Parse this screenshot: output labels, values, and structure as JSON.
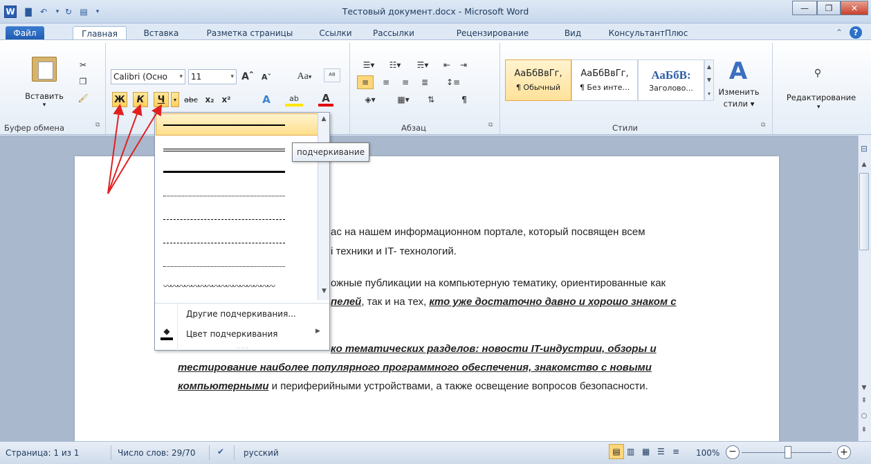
{
  "window": {
    "title": "Тестовый документ.docx - Microsoft Word",
    "app_icon": "W"
  },
  "tabs": [
    "Файл",
    "Главная",
    "Вставка",
    "Разметка страницы",
    "Ссылки",
    "Рассылки",
    "Рецензирование",
    "Вид",
    "КонсультантПлюс"
  ],
  "clipboard": {
    "paste_label": "Вставить",
    "group_label": "Буфер обмена"
  },
  "font": {
    "name": "Calibri (Осно",
    "size": "11",
    "bold": "Ж",
    "italic": "К",
    "underline": "Ч",
    "strike": "abc",
    "sub": "x₂",
    "sup": "x²",
    "aa": "Aa"
  },
  "paragraph": {
    "group_label": "Абзац",
    "pilcrow": "¶"
  },
  "styles": {
    "group_label": "Стили",
    "items": [
      {
        "preview": "АаБбВвГг,",
        "name": "¶ Обычный"
      },
      {
        "preview": "АаБбВвГг,",
        "name": "¶ Без инте..."
      },
      {
        "preview": "АаБбВ:",
        "name": "Заголово..."
      }
    ],
    "change_label": "Изменить стили",
    "change_l1": "Изменить",
    "change_l2": "стили ▾"
  },
  "editing": {
    "label": "Редактирование"
  },
  "dropdown": {
    "tooltip": "подчеркивание",
    "more_underlines": "Другие подчеркивания...",
    "underline_color": "Цвет подчеркивания"
  },
  "document": {
    "lines": [
      {
        "text": "ас на нашем информационном портале, который посвящен всем"
      },
      {
        "text": "і техники и IT- технологий."
      },
      {
        "text": "ожные публикации на компьютерную тематику, ориентированные как"
      },
      {
        "pre_bold": "пелей",
        "mid": ", так и на тех, ",
        "post_bold": "кто уже достаточно давно и хорошо знаком с"
      },
      {
        "bold": "ко тематических разделов: новости IT-индустрии, обзоры и"
      },
      {
        "bold": "тестирование наиболее популярного программного обеспечения,  знакомство с новыми"
      },
      {
        "pre_bold": "компьютерными",
        "mid": " и периферийными устройствами, а также освещение вопросов безопасности."
      }
    ]
  },
  "status": {
    "page": "Страница: 1 из 1",
    "words": "Число слов: 29/70",
    "lang": "русский",
    "zoom": "100%"
  },
  "colors": {
    "accent": "#2b579a",
    "highlight": "#ffcf5a",
    "arrow": "#e02020"
  }
}
